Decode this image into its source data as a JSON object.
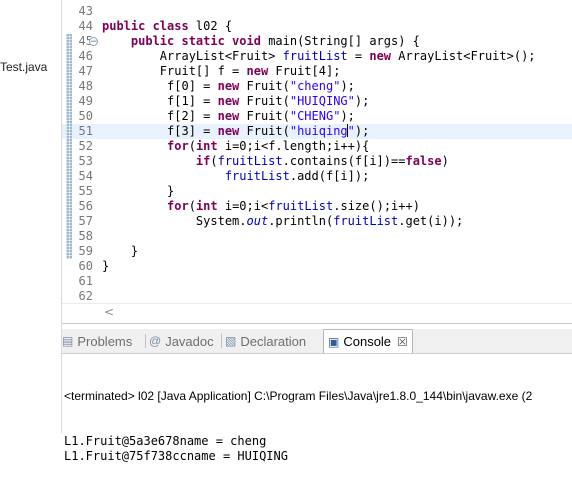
{
  "package_explorer": {
    "file_label": "Test.java"
  },
  "editor": {
    "lines": [
      {
        "n": "43",
        "segs": []
      },
      {
        "n": "44",
        "segs": [
          [
            "kw",
            "public class "
          ],
          [
            "pl",
            "l02 {"
          ]
        ]
      },
      {
        "n": "45",
        "segs": [
          [
            "pl",
            "    "
          ],
          [
            "kw",
            "public static void "
          ],
          [
            "pl",
            "main(String[] args) {"
          ]
        ]
      },
      {
        "n": "46",
        "segs": [
          [
            "pl",
            "        ArrayList<Fruit> "
          ],
          [
            "fld",
            "fruitList"
          ],
          [
            "pl",
            " = "
          ],
          [
            "kw",
            "new "
          ],
          [
            "pl",
            "ArrayList<Fruit>();"
          ]
        ]
      },
      {
        "n": "47",
        "segs": [
          [
            "pl",
            "        Fruit[] f = "
          ],
          [
            "kw",
            "new "
          ],
          [
            "pl",
            "Fruit[4];"
          ]
        ]
      },
      {
        "n": "48",
        "segs": [
          [
            "pl",
            "         f[0] = "
          ],
          [
            "kw",
            "new "
          ],
          [
            "pl",
            "Fruit("
          ],
          [
            "str",
            "\"cheng\""
          ],
          [
            "pl",
            ");"
          ]
        ]
      },
      {
        "n": "49",
        "segs": [
          [
            "pl",
            "         f[1] = "
          ],
          [
            "kw",
            "new "
          ],
          [
            "pl",
            "Fruit("
          ],
          [
            "str",
            "\"HUIQING\""
          ],
          [
            "pl",
            ");"
          ]
        ]
      },
      {
        "n": "50",
        "segs": [
          [
            "pl",
            "         f[2] = "
          ],
          [
            "kw",
            "new "
          ],
          [
            "pl",
            "Fruit("
          ],
          [
            "str",
            "\"CHENG\""
          ],
          [
            "pl",
            ");"
          ]
        ]
      },
      {
        "n": "51",
        "segs": [
          [
            "pl",
            "         f[3] = "
          ],
          [
            "kw",
            "new "
          ],
          [
            "pl",
            "Fruit("
          ],
          [
            "str",
            "\"huiqing"
          ],
          [
            "caret",
            ""
          ],
          [
            "str",
            "\""
          ],
          [
            "pl",
            ");"
          ]
        ]
      },
      {
        "n": "52",
        "segs": [
          [
            "pl",
            "         "
          ],
          [
            "kw",
            "for"
          ],
          [
            "pl",
            "("
          ],
          [
            "kw",
            "int "
          ],
          [
            "pl",
            "i=0;i<f.length;i++){"
          ]
        ]
      },
      {
        "n": "53",
        "segs": [
          [
            "pl",
            "             "
          ],
          [
            "kw",
            "if"
          ],
          [
            "pl",
            "("
          ],
          [
            "fld",
            "fruitList"
          ],
          [
            "pl",
            ".contains(f[i])=="
          ],
          [
            "kw",
            "false"
          ],
          [
            "pl",
            ")"
          ]
        ]
      },
      {
        "n": "54",
        "segs": [
          [
            "pl",
            "                 "
          ],
          [
            "fld",
            "fruitList"
          ],
          [
            "pl",
            ".add(f[i]);"
          ]
        ]
      },
      {
        "n": "55",
        "segs": [
          [
            "pl",
            "         }"
          ]
        ]
      },
      {
        "n": "56",
        "segs": [
          [
            "pl",
            "         "
          ],
          [
            "kw",
            "for"
          ],
          [
            "pl",
            "("
          ],
          [
            "kw",
            "int "
          ],
          [
            "pl",
            "i=0;i<"
          ],
          [
            "fld",
            "fruitList"
          ],
          [
            "pl",
            ".size();i++)"
          ]
        ]
      },
      {
        "n": "57",
        "segs": [
          [
            "pl",
            "             System."
          ],
          [
            "fld-static",
            "out"
          ],
          [
            "pl",
            ".println("
          ],
          [
            "fld",
            "fruitList"
          ],
          [
            "pl",
            ".get(i));"
          ]
        ]
      },
      {
        "n": "58",
        "segs": []
      },
      {
        "n": "59",
        "segs": [
          [
            "pl",
            "    }"
          ]
        ]
      },
      {
        "n": "60",
        "segs": [
          [
            "pl",
            "}"
          ]
        ]
      },
      {
        "n": "61",
        "segs": []
      },
      {
        "n": "62",
        "segs": []
      }
    ]
  },
  "fold_markers": [
    "45",
    "59"
  ],
  "hscroll": {
    "left_arrow": "<"
  },
  "tabs": [
    {
      "label": "Problems",
      "icon": "problems-icon",
      "glyph": "▤",
      "active": false
    },
    {
      "label": "Javadoc",
      "icon": "javadoc-icon",
      "glyph": "@",
      "active": false
    },
    {
      "label": "Declaration",
      "icon": "declaration-icon",
      "glyph": "▧",
      "active": false
    },
    {
      "label": "Console",
      "icon": "console-icon",
      "glyph": "▣",
      "active": true,
      "close": "☒"
    }
  ],
  "console": {
    "terminated": "<terminated> l02 [Java Application] C:\\Program Files\\Java\\jre1.8.0_144\\bin\\javaw.exe (2",
    "lines": [
      "L1.Fruit@5a3e678name = cheng",
      "L1.Fruit@75f738ccname = HUIQING"
    ]
  },
  "colors": {
    "keyword": "#7f0055",
    "string": "#2a00ff",
    "field": "#0000c0",
    "current_line": "#e8f2fe"
  }
}
